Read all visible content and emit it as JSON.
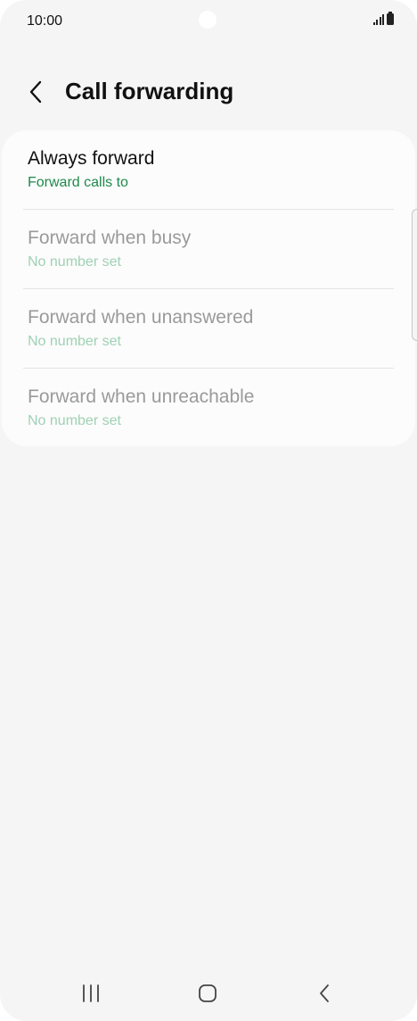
{
  "status_bar": {
    "time": "10:00"
  },
  "header": {
    "title": "Call forwarding",
    "back_icon": "chevron-left-icon"
  },
  "items": [
    {
      "title": "Always forward",
      "subtitle": "Forward calls to",
      "enabled": true
    },
    {
      "title": "Forward when busy",
      "subtitle": "No number set",
      "enabled": false
    },
    {
      "title": "Forward when unanswered",
      "subtitle": "No number set",
      "enabled": false
    },
    {
      "title": "Forward when unreachable",
      "subtitle": "No number set",
      "enabled": false
    }
  ],
  "navigation": {
    "recents_icon": "recents-icon",
    "home_icon": "home-icon",
    "back_icon": "back-icon"
  },
  "colors": {
    "accent": "#1f8a4c",
    "background": "#f5f5f5",
    "card": "#fcfcfc",
    "disabled_text": "#9a9a9a"
  }
}
